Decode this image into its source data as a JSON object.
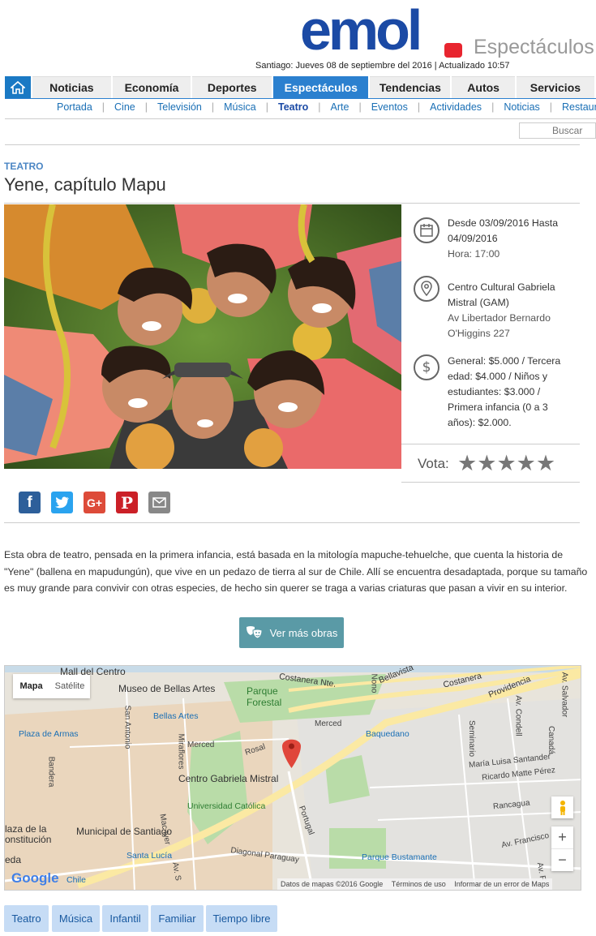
{
  "header": {
    "logo_text": "emol",
    "section_title": "Espectáculos",
    "dateline": "Santiago: Jueves 08 de septiembre del 2016 | Actualizado 10:57"
  },
  "main_nav": {
    "items": [
      "Noticias",
      "Economía",
      "Deportes",
      "Espectáculos",
      "Tendencias",
      "Autos",
      "Servicios"
    ],
    "active": "Espectáculos"
  },
  "sub_nav": {
    "items": [
      "Portada",
      "Cine",
      "Televisión",
      "Música",
      "Teatro",
      "Arte",
      "Eventos",
      "Actividades",
      "Noticias",
      "Restaura"
    ],
    "active": "Teatro"
  },
  "search": {
    "placeholder": "Buscar"
  },
  "article": {
    "category": "TEATRO",
    "title": "Yene, capítulo Mapu",
    "dates": "Desde 03/09/2016 Hasta 04/09/2016",
    "time": "Hora: 17:00",
    "venue": "Centro Cultural Gabriela Mistral (GAM)",
    "address": "Av Libertador Bernardo O'Higgins 227",
    "prices": "General: $5.000 / Tercera edad: $4.000 / Niños y estudiantes: $3.000 / Primera infancia (0 a 3 años): $2.000.",
    "vote_label": "Vota:",
    "rating": {
      "value": 0,
      "max": 5
    },
    "body": "Esta obra de teatro, pensada en la primera infancia, está basada en la mitología mapuche-tehuelche, que cuenta la historia de \"Yene\" (ballena en mapudungún), que vive en un pedazo de tierra al sur de Chile. Allí se encuentra desadaptada, porque su tamaño es muy grande para convivir con otras especies, de hecho sin querer se traga a varias criaturas que pasan a vivir en su interior.",
    "more_button": "Ver más obras"
  },
  "share": {
    "icons": [
      "facebook-icon",
      "twitter-icon",
      "google-plus-icon",
      "pinterest-icon",
      "email-icon"
    ],
    "colors": {
      "facebook": "#2d5f9a",
      "twitter": "#2aa3ef",
      "google_plus": "#dd4b39",
      "pinterest": "#cb2027",
      "email": "#888888"
    }
  },
  "map": {
    "type_buttons": [
      "Mapa",
      "Satélite"
    ],
    "labels": {
      "mall": "Mall del Centro",
      "museo": "Museo de Bellas Artes",
      "parque_forestal": "Parque Forestal",
      "costanera_nte": "Costanera Nte.",
      "costanera": "Costanera",
      "providencia": "Providencia",
      "bellavista": "Bellavista",
      "nono": "Nono",
      "salvador": "Av. Salvador",
      "condell": "Av. Condell",
      "canada": "Canadá",
      "bellas_artes": "Bellas Artes",
      "merced1": "Merced",
      "merced2": "Merced",
      "baquedano": "Baquedano",
      "seminario": "Seminario",
      "plaza_armas": "Plaza de Armas",
      "san_antonio": "San Antonio",
      "miraflores": "Miraflores",
      "rosal": "Rosal",
      "centro_gam": "Centro Gabriela Mistral",
      "bandera": "Bandera",
      "maria_luisa": "María Luisa Santander",
      "ricardo_matte": "Ricardo Matte Pérez",
      "rancagua": "Rancagua",
      "universidad_catolica": "Universidad Católica",
      "portugal": "Portugal",
      "plaza_constitucion": "laza de la\nonstitución",
      "municipal": "Municipal de Santiago",
      "mac_iver": "Mac Iver",
      "av_francisco": "Av. Francisco",
      "santa_lucia": "Santa Lucía",
      "diagonal_paraguay": "Diagonal Paraguay",
      "parque_bustamante": "Parque Bustamante",
      "eda": "eda",
      "chile": "Chile",
      "google": "Google",
      "av_s": "Av. S",
      "av_francisco2": "Av. F"
    },
    "attribution": "Datos de mapas ©2016 Google",
    "terms": "Términos de uso",
    "report": "Informar de un error de Maps",
    "zoom_in": "+",
    "zoom_out": "−"
  },
  "tags": [
    "Teatro",
    "Música",
    "Infantil",
    "Familiar",
    "Tiempo libre"
  ]
}
